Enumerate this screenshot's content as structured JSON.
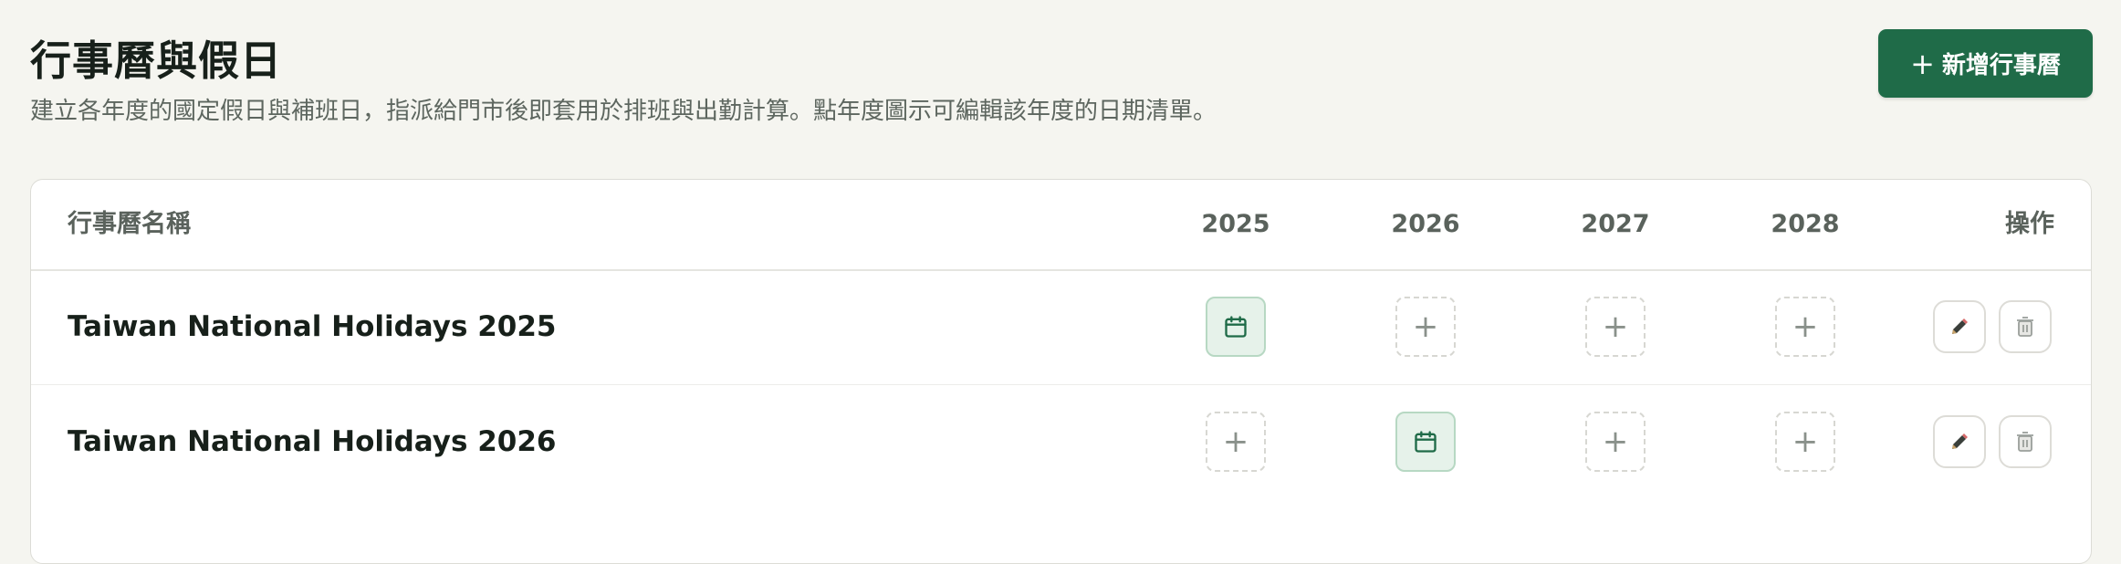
{
  "header": {
    "title": "行事曆與假日",
    "subtitle": "建立各年度的國定假日與補班日，指派給門市後即套用於排班與出勤計算。點年度圖示可編輯該年度的日期清單。",
    "add_button_label": "新增行事曆",
    "add_button_icon": "plus-icon"
  },
  "table": {
    "columns": {
      "name": "行事曆名稱",
      "years": [
        "2025",
        "2026",
        "2027",
        "2028"
      ],
      "actions": "操作"
    },
    "rows": [
      {
        "name": "Taiwan National Holidays 2025",
        "years": [
          "calendar",
          "add",
          "add",
          "add"
        ]
      },
      {
        "name": "Taiwan National Holidays 2026",
        "years": [
          "add",
          "calendar",
          "add",
          "add"
        ]
      }
    ]
  },
  "icons": {
    "filled_cell": "calendar-icon",
    "empty_cell": "plus-icon",
    "edit": "pencil-icon",
    "delete": "trash-icon"
  },
  "colors": {
    "background": "#f5f5f0",
    "primary": "#1f6b48",
    "filled_cell_bg": "#e6f2ea",
    "filled_cell_border": "#b7d8c3",
    "text_dark": "#17201a",
    "text_muted": "#5d665f"
  }
}
